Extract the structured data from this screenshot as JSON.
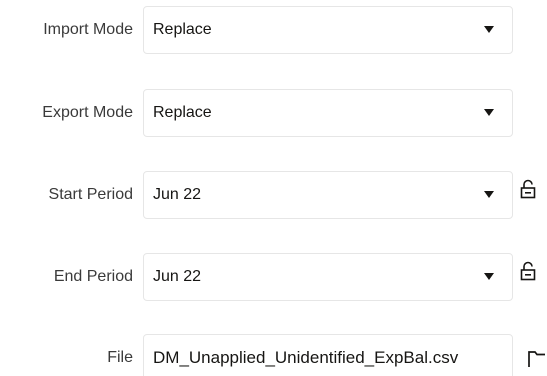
{
  "fields": {
    "import_mode": {
      "label": "Import Mode",
      "value": "Replace"
    },
    "export_mode": {
      "label": "Export Mode",
      "value": "Replace"
    },
    "start_period": {
      "label": "Start Period",
      "value": "Jun 22"
    },
    "end_period": {
      "label": "End Period",
      "value": "Jun 22"
    },
    "file": {
      "label": "File",
      "value": "DM_Unapplied_Unidentified_ExpBal.csv"
    }
  },
  "icons": {
    "dropdown": "caret-down-icon",
    "period_lock": "unlocked-padlock-icon",
    "file_browse": "folder-icon"
  }
}
